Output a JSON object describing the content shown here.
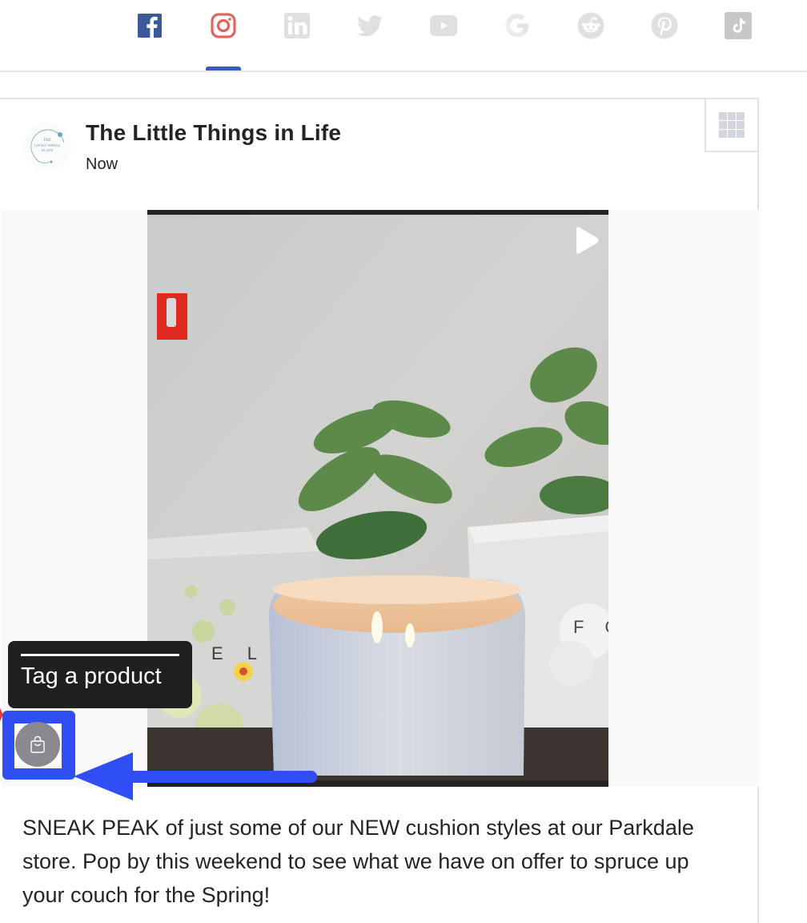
{
  "social_tabs": {
    "active": "instagram",
    "items": [
      {
        "id": "facebook",
        "icon": "facebook-icon",
        "color": "#3b5998",
        "active": false
      },
      {
        "id": "instagram",
        "icon": "instagram-icon",
        "color": "#e1645f",
        "active": true
      },
      {
        "id": "linkedin",
        "icon": "linkedin-icon",
        "color": "#e0e0e0",
        "active": false
      },
      {
        "id": "twitter",
        "icon": "twitter-icon",
        "color": "#e0e0e0",
        "active": false
      },
      {
        "id": "youtube",
        "icon": "youtube-icon",
        "color": "#e0e0e0",
        "active": false
      },
      {
        "id": "google",
        "icon": "google-icon",
        "color": "#e0e0e0",
        "active": false
      },
      {
        "id": "reddit",
        "icon": "reddit-icon",
        "color": "#e0e0e0",
        "active": false
      },
      {
        "id": "pinterest",
        "icon": "pinterest-icon",
        "color": "#e0e0e0",
        "active": false
      },
      {
        "id": "tiktok",
        "icon": "tiktok-icon",
        "color": "#c8c8c8",
        "active": false
      }
    ],
    "accent_color": "#2d5fc6"
  },
  "post": {
    "page_name": "The Little Things in Life",
    "timestamp": "Now",
    "avatar_text": [
      "THE",
      "LITTLE THINGS",
      "IN LIFE"
    ],
    "caption": "SNEAK PEAK of just some of our NEW cushion styles at our Parkdale store. Pop by this weekend to see what we have on offer to spruce up your couch for the Spring!",
    "media_type": "video",
    "video_box_letters": {
      "left": "E L",
      "right": "F O"
    }
  },
  "overlay": {
    "tooltip_label": "Tag a product",
    "highlight_color": "#2f4ff5"
  }
}
